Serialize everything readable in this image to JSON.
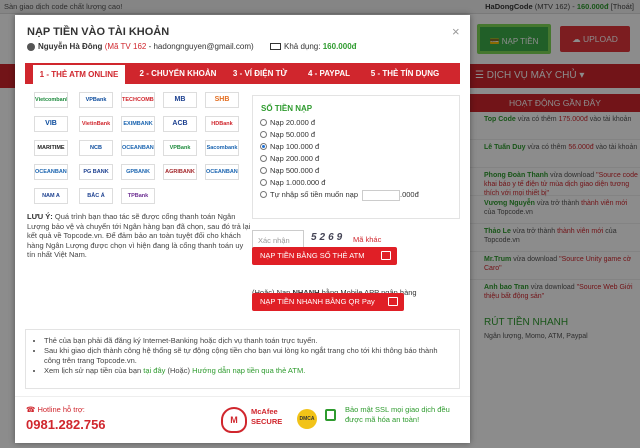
{
  "background": {
    "topbar_left": "Sàn giao dịch code chất lượng cao!",
    "topbar_user": "HaDongCode",
    "topbar_mtv": "(MTV 162) -",
    "topbar_balance": "160.000đ",
    "topbar_logout": "[Thoát]",
    "naptien_label": "NẠP TIỀN",
    "upload_label": "UPLOAD",
    "nav_label": "DỊCH VỤ MÁY CHỦ",
    "sidebar_title": "HOẠT ĐỘNG GẦN ĐÂY",
    "activities": [
      {
        "name": "Top Code",
        "action": "vừa có thêm",
        "value": "175.000đ",
        "tail": "vào tài khoản"
      },
      {
        "name": "Lê Tuấn Duy",
        "action": "vừa có thêm",
        "value": "56.000đ",
        "tail": "vào tài khoản"
      },
      {
        "name": "Phong Đoàn Thanh",
        "action": "vừa download",
        "value": "\"Source code khai báo y tế điện tử mùa dịch giao diện tương thích với mọi thiết bị\"",
        "tail": ""
      },
      {
        "name": "Vương Nguyễn",
        "action": "vừa trở thành",
        "value": "thành viên mới",
        "tail": "của Topcode.vn"
      },
      {
        "name": "Thảo Le",
        "action": "vừa trở thành",
        "value": "thành viên mới",
        "tail": "của Topcode.vn"
      },
      {
        "name": "Mr.Trum",
        "action": "vừa download",
        "value": "\"Source Unity game cờ Caro\"",
        "tail": ""
      },
      {
        "name": "Anh bao Tran",
        "action": "vừa download",
        "value": "\"Source Web Giới thiệu bất động sản\"",
        "tail": ""
      }
    ],
    "rut_title": "RÚT TIỀN NHANH",
    "rut_sub": "Ngân lượng, Momo, ATM, Paypal"
  },
  "modal": {
    "title": "NẠP TIỀN VÀO TÀI KHOẢN",
    "close": "×",
    "user_name": "Nguyễn Hà Đông",
    "user_mtv": "(Mã TV 162",
    "user_email": "- hadongnguyen@gmail.com)",
    "balance_label": "Khả dụng:",
    "balance_value": "160.000đ",
    "tabs": [
      "1 - THẺ ATM ONLINE",
      "2 - CHUYỂN KHOẢN",
      "3 - VÍ ĐIỆN TỬ",
      "4 - PAYPAL",
      "5 - THẺ TÍN DỤNG"
    ],
    "banks": [
      "Vietcombank",
      "VPBank",
      "TECHCOMBANK",
      "MB",
      "SHB",
      "VIB",
      "VietinBank",
      "EXIMBANK",
      "ACB",
      "HDBank",
      "MARITIME",
      "NCB",
      "OCEANBANK",
      "VPBank",
      "Sacombank",
      "OCEANBANK",
      "PG BANK",
      "GPBANK",
      "AGRIBANK",
      "OCEANBANK",
      "NAM A BANK",
      "BẮC Á BANK",
      "TPBank"
    ],
    "note_label": "LƯU Ý:",
    "note_text": "Quá trình bạn thao tác sẽ được cổng thanh toán Ngân Lượng bảo vệ và chuyển tới Ngân hàng bạn đã chọn, sau đó trả lại kết quả về Topcode.vn. Để đảm bảo an toàn tuyệt đối cho khách hàng Ngân Lượng được chọn vì hiện đang là cổng thanh toán uy tín nhất Việt Nam.",
    "amount_title": "SỐ TIỀN NẠP",
    "amounts": [
      "Nạp 20.000 đ",
      "Nạp 50.000 đ",
      "Nạp 100.000 đ",
      "Nạp 200.000 đ",
      "Nạp 500.000 đ",
      "Nạp 1.000.000 đ",
      "Tự nhập số tiền muốn nạp"
    ],
    "selected_amount": "Nạp 100.000 đ",
    "custom_suffix": ".000đ",
    "captcha_placeholder": "Xác nhận",
    "captcha_code": "5269",
    "captcha_other": "Mã khác",
    "btn_atm": "NẠP TIỀN BẰNG SỐ THẺ ATM",
    "or_text_1": "(Hoặc) Nạp",
    "or_text_bold": "NHANH",
    "or_text_2": "bằng Mobile APP ngân hàng",
    "btn_qr": "NẠP TIỀN NHANH BẰNG QR Pay",
    "info": [
      "Thẻ của bạn phải đã đăng ký Internet-Banking hoặc dịch vụ thanh toán trực tuyến.",
      "Sau khi giao dịch thành công hệ thống sẽ tự động cộng tiền cho bạn vui lòng ko ngắt trang cho tới khi thông báo thành công trên trang Topcode.vn.",
      "Xem lịch sử nạp tiền của bạn"
    ],
    "info_link1": "tại đây",
    "info_mid": "(Hoặc)",
    "info_link2": "Hướng dẫn nạp tiền qua thẻ ATM.",
    "hotline_label": "Hotline hỗ trợ:",
    "hotline_phone": "0981.282.756",
    "badge_mcafee": "McAfee SECURE",
    "badge_dmca": "DMCA",
    "ssl_text": "Bảo mật SSL mọi giao dịch đều được mã hóa an toàn!"
  },
  "colors": {
    "brand_red": "#d0262d",
    "green": "#2e9b2e"
  }
}
